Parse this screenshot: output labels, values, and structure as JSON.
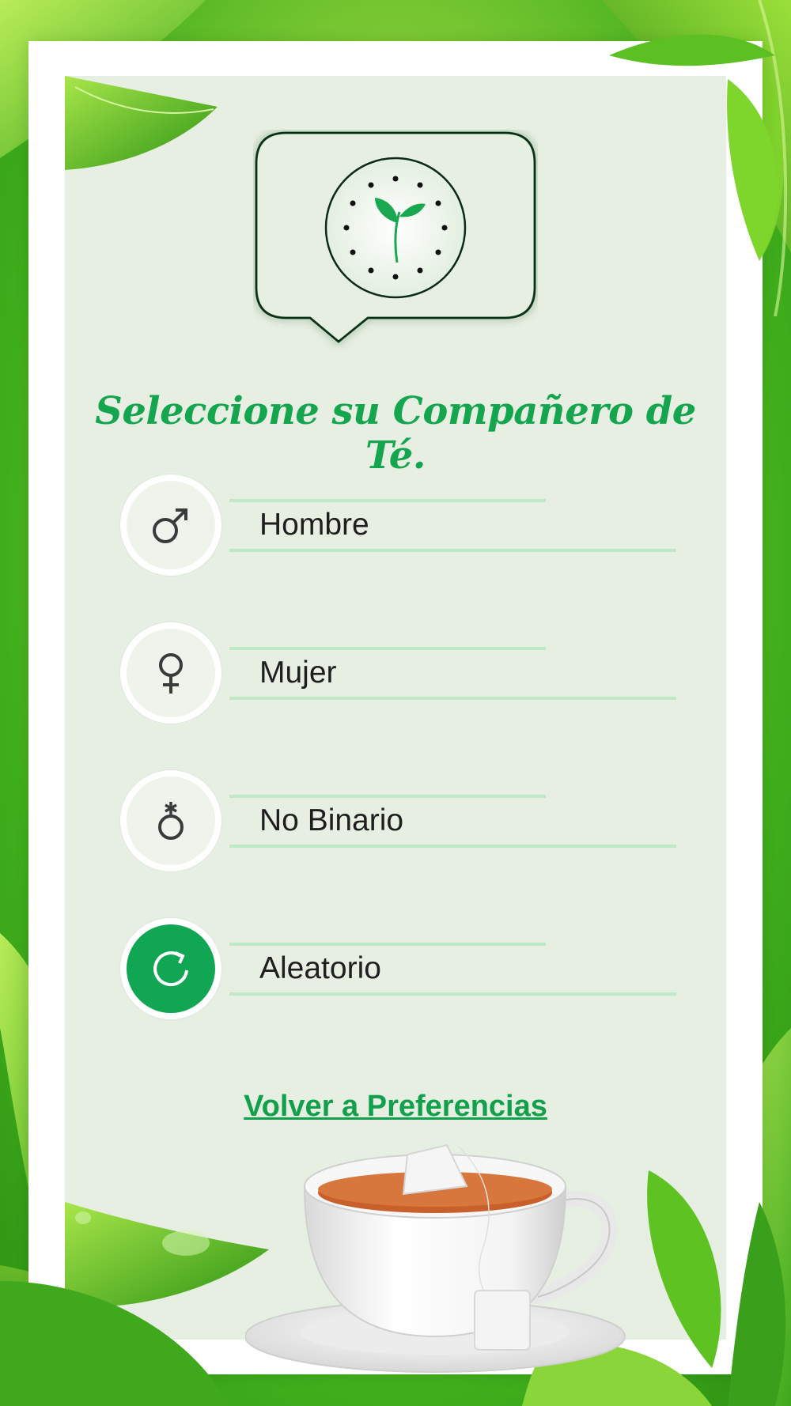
{
  "title": "Seleccione su Compañero de Té.",
  "options": [
    {
      "label": "Hombre",
      "icon": "male-symbol-icon",
      "selected": false
    },
    {
      "label": "Mujer",
      "icon": "female-symbol-icon",
      "selected": false
    },
    {
      "label": "No Binario",
      "icon": "nonbinary-symbol-icon",
      "selected": false
    },
    {
      "label": "Aleatorio",
      "icon": "refresh-icon",
      "selected": true
    }
  ],
  "back_link": "Volver a Preferencias",
  "colors": {
    "accent": "#14a54e",
    "panel": "#e6efe2",
    "divider": "#bfe8c9",
    "active_circle": "#10a653"
  }
}
